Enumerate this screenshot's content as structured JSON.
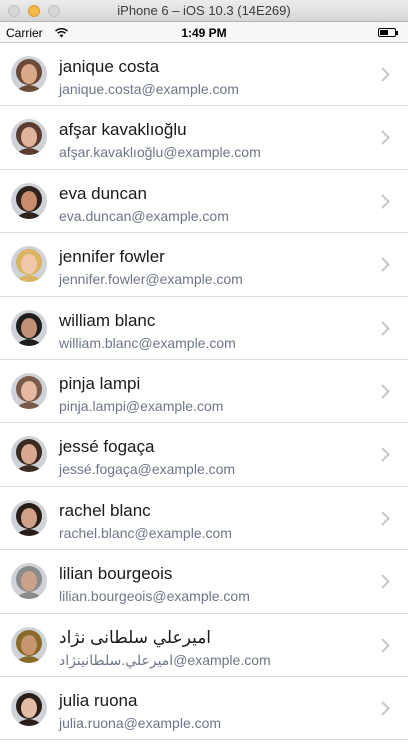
{
  "window": {
    "title": "iPhone 6 – iOS 10.3 (14E269)"
  },
  "status_bar": {
    "carrier": "Carrier",
    "time": "1:49 PM"
  },
  "contacts": [
    {
      "name": "janique costa",
      "email": "janique.costa@example.com",
      "avatar_color": "#6b4a3a",
      "skin": "#d9a98a"
    },
    {
      "name": "afşar kavaklıoğlu",
      "email": "afşar.kavaklıoğlu@example.com",
      "avatar_color": "#5a3d30",
      "skin": "#e0b39a"
    },
    {
      "name": "eva duncan",
      "email": "eva.duncan@example.com",
      "avatar_color": "#2d221e",
      "skin": "#c98d6e"
    },
    {
      "name": "jennifer fowler",
      "email": "jennifer.fowler@example.com",
      "avatar_color": "#d8b463",
      "skin": "#f0c8a8"
    },
    {
      "name": "william blanc",
      "email": "william.blanc@example.com",
      "avatar_color": "#1e1e1e",
      "skin": "#c29075"
    },
    {
      "name": "pinja lampi",
      "email": "pinja.lampi@example.com",
      "avatar_color": "#7a5a4a",
      "skin": "#e4b9a0"
    },
    {
      "name": "jessé fogaça",
      "email": "jessé.fogaça@example.com",
      "avatar_color": "#3a2a22",
      "skin": "#d8a890"
    },
    {
      "name": "rachel blanc",
      "email": "rachel.blanc@example.com",
      "avatar_color": "#2a1e1a",
      "skin": "#d0a088"
    },
    {
      "name": "lilian bourgeois",
      "email": "lilian.bourgeois@example.com",
      "avatar_color": "#8a8a8a",
      "skin": "#caa28a"
    },
    {
      "name": "اميرعلي سلطانی نژاد",
      "email": "اميرعلي.سلطانينژاد@example.com",
      "avatar_color": "#8a6a2a",
      "skin": "#c9956f"
    },
    {
      "name": "julia ruona",
      "email": "julia.ruona@example.com",
      "avatar_color": "#2a1e1a",
      "skin": "#e2bca6"
    }
  ]
}
